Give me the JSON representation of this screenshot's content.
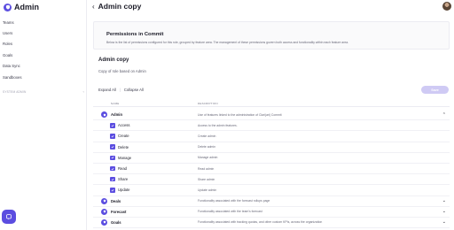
{
  "brand": {
    "name": "Admin"
  },
  "sidebar": {
    "items": [
      {
        "label": "Teams"
      },
      {
        "label": "Users"
      },
      {
        "label": "Roles"
      },
      {
        "label": "Goals"
      },
      {
        "label": "Data Sync"
      },
      {
        "label": "Sandboxes"
      }
    ],
    "section_label": "SYSTEM ADMIN"
  },
  "header": {
    "title": "Admin copy"
  },
  "panel": {
    "title": "Permissions in Commit",
    "description": "Below is the list of permissions configured for this role, grouped by feature area. The management of these permissions govern both access and functionality within each feature area."
  },
  "role": {
    "title": "Admin copy",
    "subtitle": "Copy of role based on Admin"
  },
  "actions": {
    "expand_all": "Expand All",
    "collapse_all": "Collapse All",
    "save": "Save"
  },
  "table": {
    "col_name": "NAME",
    "col_description": "DESCRIPTION",
    "rows": [
      {
        "kind": "group",
        "name": "Admin",
        "description": "Use of features linked to the administration of Clari(ari) Commit",
        "chevron": "⌃"
      },
      {
        "kind": "perm",
        "name": "Access",
        "description": "Access to the admin features."
      },
      {
        "kind": "perm",
        "name": "Create",
        "description": "Create admin"
      },
      {
        "kind": "perm",
        "name": "Delete",
        "description": "Delete admin"
      },
      {
        "kind": "perm",
        "name": "Manage",
        "description": "Manage admin"
      },
      {
        "kind": "perm",
        "name": "Read",
        "description": "Read admin"
      },
      {
        "kind": "perm",
        "name": "Share",
        "description": "Share admin"
      },
      {
        "kind": "perm",
        "name": "Update",
        "description": "Update admin"
      },
      {
        "kind": "group",
        "name": "Deals",
        "description": "Functionality associated with the forecast rollups page",
        "chevron": "⌄"
      },
      {
        "kind": "group",
        "name": "Forecast",
        "description": "Functionality associated with the team's forecast",
        "chevron": "⌄"
      },
      {
        "kind": "group",
        "name": "Goals",
        "description": "Functionality associated with tracking quotas, and other custom KPIs, across the organization",
        "chevron": "⌄"
      }
    ]
  },
  "colors": {
    "accent": "#5b4de0",
    "save_disabled": "#cfcaf4"
  }
}
